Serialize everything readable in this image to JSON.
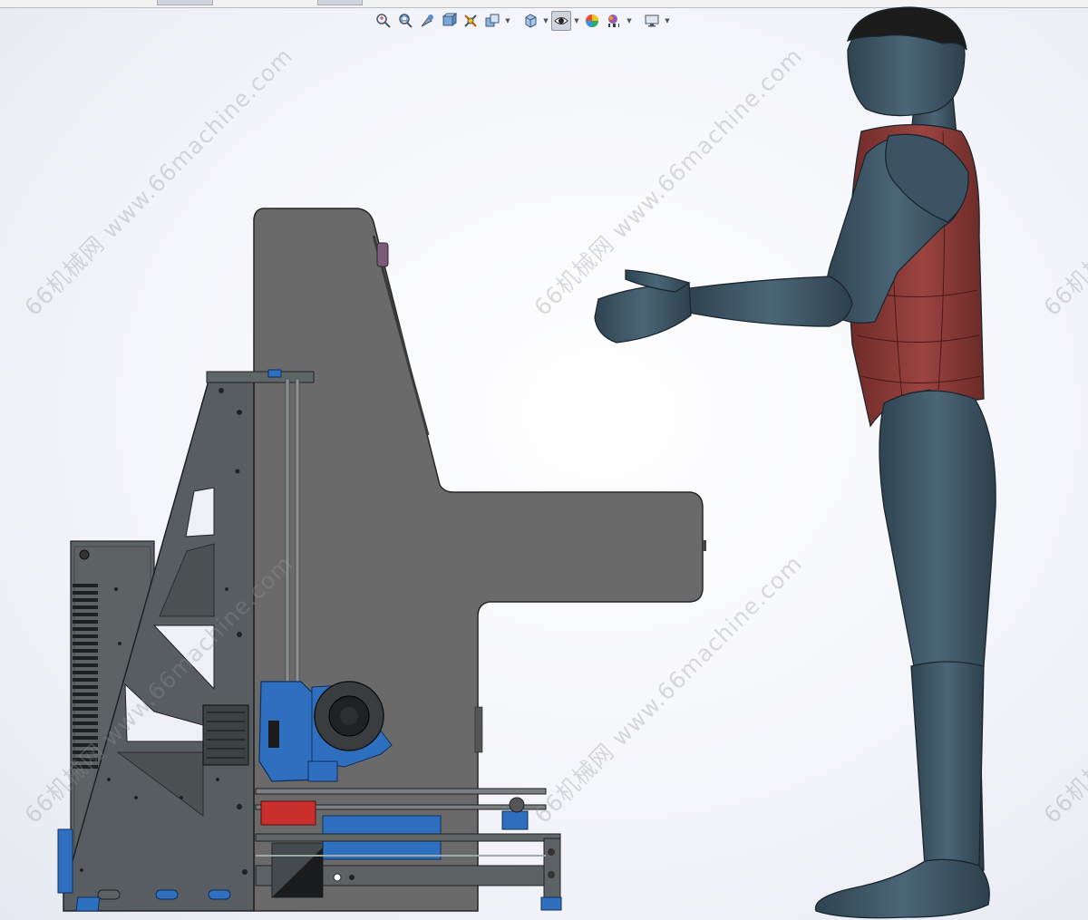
{
  "toolbar": {
    "tools": [
      {
        "id": "zoom-to-fit",
        "label": "Zoom to Fit",
        "icon": "zoom-fit-icon"
      },
      {
        "id": "zoom-area",
        "label": "Zoom to Area",
        "icon": "zoom-area-icon"
      },
      {
        "id": "previous-view",
        "label": "Previous View",
        "icon": "previous-view-icon"
      },
      {
        "id": "section-view",
        "label": "Section View",
        "icon": "section-view-icon"
      },
      {
        "id": "dynamic-annotation",
        "label": "Dynamic Annotation Views",
        "icon": "annotation-icon"
      },
      {
        "id": "view-orientation",
        "label": "View Orientation",
        "icon": "view-orientation-icon"
      },
      {
        "id": "display-style",
        "label": "Display Style",
        "icon": "display-style-icon"
      },
      {
        "id": "hide-show-items",
        "label": "Hide/Show Items",
        "icon": "eye-icon"
      },
      {
        "id": "edit-appearance",
        "label": "Edit Appearance",
        "icon": "appearance-icon"
      },
      {
        "id": "apply-scene",
        "label": "Apply Scene",
        "icon": "scene-icon"
      },
      {
        "id": "view-settings",
        "label": "View Settings",
        "icon": "monitor-icon"
      }
    ]
  },
  "watermark": {
    "text": "66机械网 www.66machine.com"
  },
  "colors": {
    "frame": "#555b5e",
    "frame_light": "#6d7274",
    "blue_part": "#2f6fc0",
    "mannequin": "#3f5665",
    "vest": "#8c3a37",
    "hair": "#1c1c1c"
  }
}
